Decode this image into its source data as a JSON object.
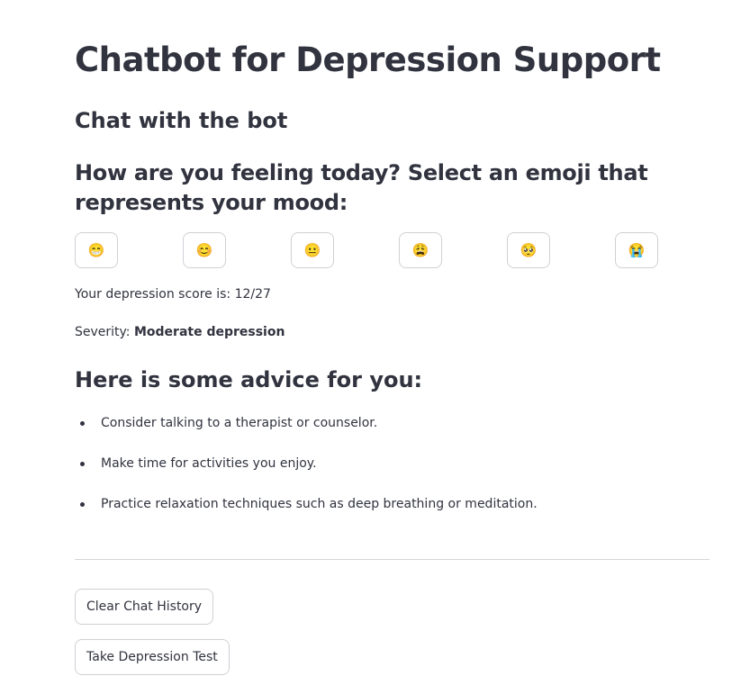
{
  "title": "Chatbot for Depression Support",
  "chat_heading": "Chat with the bot",
  "mood": {
    "prompt": "How are you feeling today? Select an emoji that represents your mood:",
    "emojis": [
      {
        "glyph": "😁",
        "icon": "grinning-face-icon"
      },
      {
        "glyph": "😊",
        "icon": "smiling-face-icon"
      },
      {
        "glyph": "😐",
        "icon": "neutral-face-icon"
      },
      {
        "glyph": "😩",
        "icon": "weary-face-icon"
      },
      {
        "glyph": "🥺",
        "icon": "pleading-face-icon"
      },
      {
        "glyph": "😭",
        "icon": "crying-face-icon"
      }
    ]
  },
  "score": {
    "text": "Your depression score is: 12/27",
    "severity_label": "Severity: ",
    "severity_value": "Moderate depression"
  },
  "advice": {
    "heading": "Here is some advice for you:",
    "items": [
      "Consider talking to a therapist or counselor.",
      "Make time for activities you enjoy.",
      "Practice relaxation techniques such as deep breathing or meditation."
    ]
  },
  "actions": {
    "clear_label": "Clear Chat History",
    "test_label": "Take Depression Test"
  }
}
